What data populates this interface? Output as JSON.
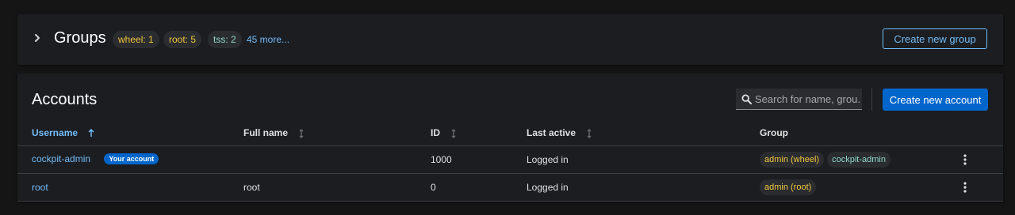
{
  "groups": {
    "title": "Groups",
    "chips": [
      {
        "label": "wheel: 1"
      },
      {
        "label": "root: 5"
      },
      {
        "label": "tss: 2"
      }
    ],
    "more_link": "45 more...",
    "create_button": "Create new group"
  },
  "accounts": {
    "title": "Accounts",
    "search_placeholder": "Search for name, grou...",
    "create_button": "Create new account",
    "columns": {
      "username": "Username",
      "full_name": "Full name",
      "id": "ID",
      "last_active": "Last active",
      "group": "Group"
    },
    "rows": [
      {
        "username": "cockpit-admin",
        "badge": "Your account",
        "full_name": "",
        "id": "1000",
        "last_active": "Logged in",
        "groups": [
          "admin (wheel)",
          "cockpit-admin"
        ]
      },
      {
        "username": "root",
        "full_name": "root",
        "id": "0",
        "last_active": "Logged in",
        "groups": [
          "admin (root)"
        ]
      }
    ]
  },
  "colors": {
    "accent": "#73bcf7",
    "primary_button": "#0066cc",
    "admin_chip_text": "#f0c53d",
    "group_chip_text": "#8fd6c8",
    "card_background": "#1b1d21",
    "page_background": "#151515"
  },
  "icons": {
    "groups_toggle": "chevron-right-icon",
    "search": "search-icon",
    "sort_active": "sort-ascending-icon",
    "sort_inactive": "sort-icon",
    "row_actions": "kebab-icon"
  }
}
